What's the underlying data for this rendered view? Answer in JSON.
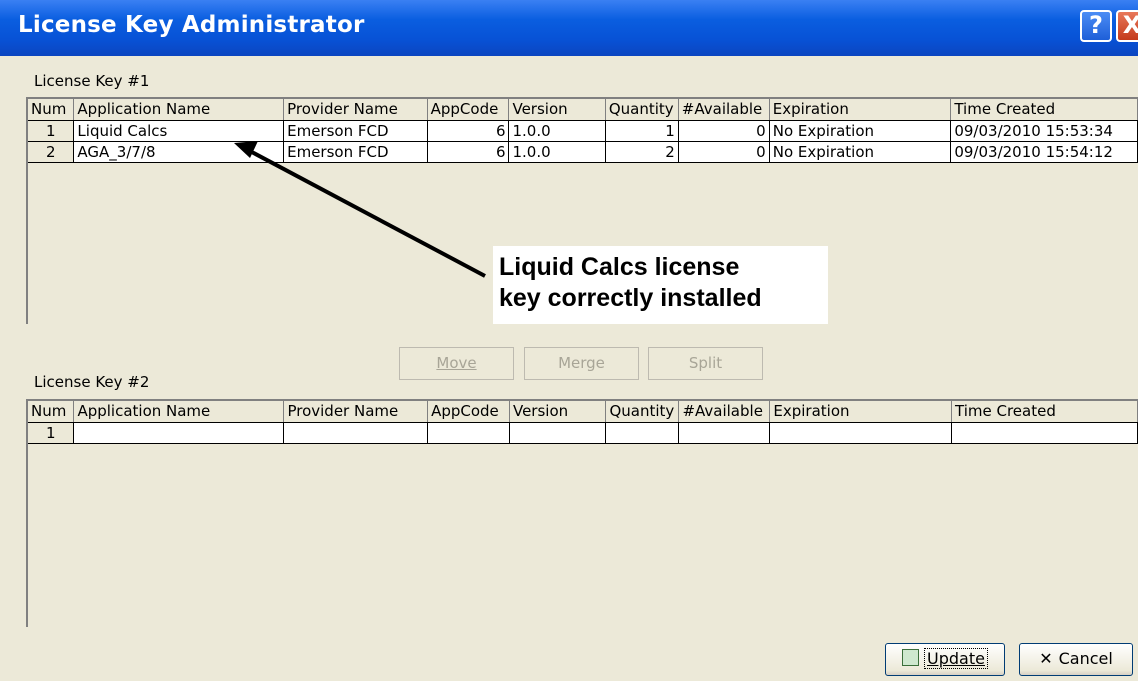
{
  "window": {
    "title": "License Key Administrator",
    "help_glyph": "?",
    "close_glyph": "X"
  },
  "columns": [
    "Num",
    "Application Name",
    "Provider Name",
    "AppCode",
    "Version",
    "Quantity",
    "#Available",
    "Expiration",
    "Time Created"
  ],
  "key1": {
    "label": "License Key #1",
    "rows": [
      {
        "num": "1",
        "app": "Liquid Calcs",
        "provider": "Emerson FCD",
        "appcode": "6",
        "version": "1.0.0",
        "quantity": "1",
        "available": "0",
        "expiration": "No Expiration",
        "created": "09/03/2010 15:53:34"
      },
      {
        "num": "2",
        "app": "AGA_3/7/8",
        "provider": "Emerson FCD",
        "appcode": "6",
        "version": "1.0.0",
        "quantity": "2",
        "available": "0",
        "expiration": "No Expiration",
        "created": "09/03/2010 15:54:12"
      }
    ]
  },
  "key2": {
    "label": "License Key #2",
    "rows": [
      {
        "num": "1",
        "app": "",
        "provider": "",
        "appcode": "",
        "version": "",
        "quantity": "",
        "available": "",
        "expiration": "",
        "created": ""
      }
    ]
  },
  "buttons": {
    "move": "Move",
    "merge": "Merge",
    "split": "Split",
    "update": "Update",
    "cancel": "Cancel"
  },
  "annotation": {
    "line1": "Liquid Calcs license",
    "line2": "key correctly installed"
  }
}
